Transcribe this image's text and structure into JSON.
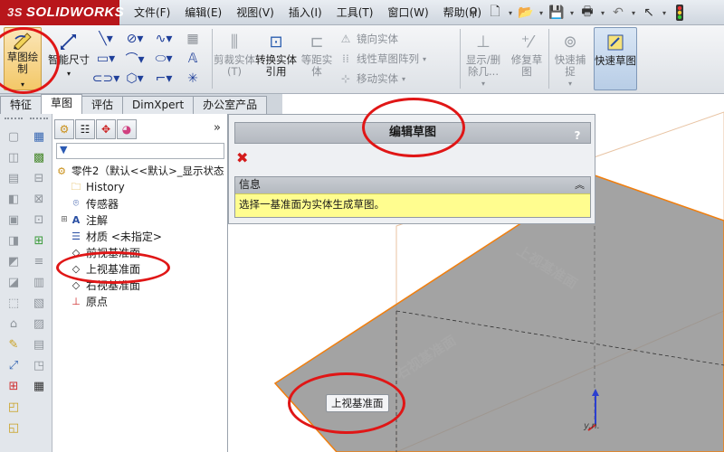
{
  "app": {
    "logo_text": "SOLIDWORKS",
    "logo_mark": "3S"
  },
  "menus": [
    "文件(F)",
    "编辑(E)",
    "视图(V)",
    "插入(I)",
    "工具(T)",
    "窗口(W)",
    "帮助(H)"
  ],
  "quick_tools": [
    "pin-icon",
    "new-document-icon",
    "open-folder-icon",
    "save-icon",
    "print-icon",
    "undo-icon",
    "select-pointer-icon",
    "rebuild-traffic-light-icon"
  ],
  "ribbon": {
    "sketch_label": "草图绘制",
    "smart_dim_label": "智能尺寸",
    "trim_label": "剪裁实体(T)",
    "convert_label": "转换实体引用",
    "offset_label": "等距实体",
    "mirror_label": "镜向实体",
    "linear_pattern_label": "线性草图阵列",
    "move_label": "移动实体",
    "show_delete_label": "显示/删除几...",
    "repair_label": "修复草图",
    "quick_snap_label": "快速捕捉",
    "quick_view_label": "快速草图"
  },
  "tabs": [
    "特征",
    "草图",
    "评估",
    "DimXpert",
    "办公室产品"
  ],
  "active_tab": "草图",
  "feature_manager": {
    "filter_icon": "funnel-icon",
    "root_label": "零件2（默认<<默认>_显示状态",
    "items": [
      {
        "label": "History",
        "icon": "history-folder-icon"
      },
      {
        "label": "传感器",
        "icon": "sensor-icon"
      },
      {
        "label": "注解",
        "icon": "annotation-icon"
      },
      {
        "label": "材质 <未指定>",
        "icon": "material-icon"
      },
      {
        "label": "前视基准面",
        "icon": "plane-icon"
      },
      {
        "label": "上视基准面",
        "icon": "plane-icon"
      },
      {
        "label": "右视基准面",
        "icon": "plane-icon"
      },
      {
        "label": "原点",
        "icon": "origin-icon"
      }
    ]
  },
  "property_manager": {
    "title": "编辑草图",
    "help": "?",
    "info_header": "信息",
    "info_collapse": "︽",
    "info_text": "选择一基准面为实体生成草图。"
  },
  "graphics": {
    "plane_labels": [
      "上视基准面",
      "右视基准面"
    ],
    "tooltip": "上视基准面",
    "triad_label": "y.n."
  },
  "colors": {
    "logo_red": "#b8161b",
    "plane_fill": "#8c8c8c",
    "plane_edge": "#f07f0f",
    "annotation_red": "#e01616",
    "info_yellow": "#fffd8f"
  }
}
